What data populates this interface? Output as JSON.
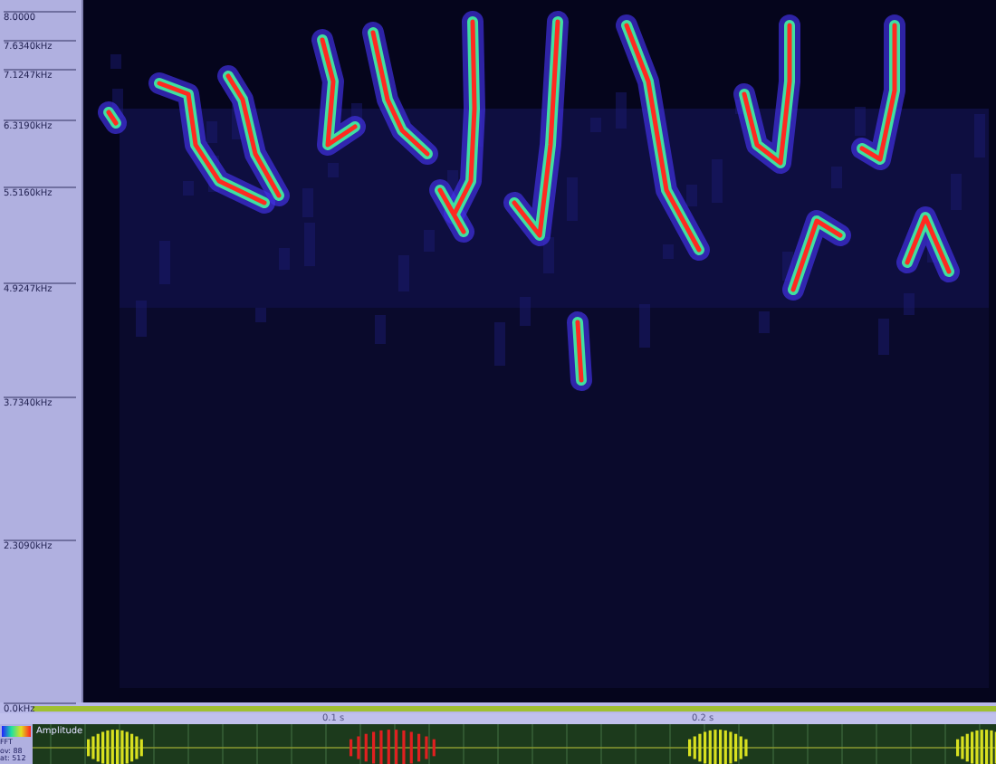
{
  "frequency_axis": {
    "labels": [
      "8.0000",
      "7.6340kHz",
      "7.1247kHz",
      "6.3190kHz",
      "5.5160kHz",
      "4.9247kHz",
      "3.7340kHz",
      "2.3090kHz",
      "0.0kHz"
    ]
  },
  "time_ruler": {
    "labels": [
      "0.1 s",
      "0.2 s"
    ]
  },
  "waveform": {
    "label": "Amplitude"
  },
  "legend": {
    "lines": [
      "FFT",
      "ov: 88",
      "at: 512"
    ]
  }
}
